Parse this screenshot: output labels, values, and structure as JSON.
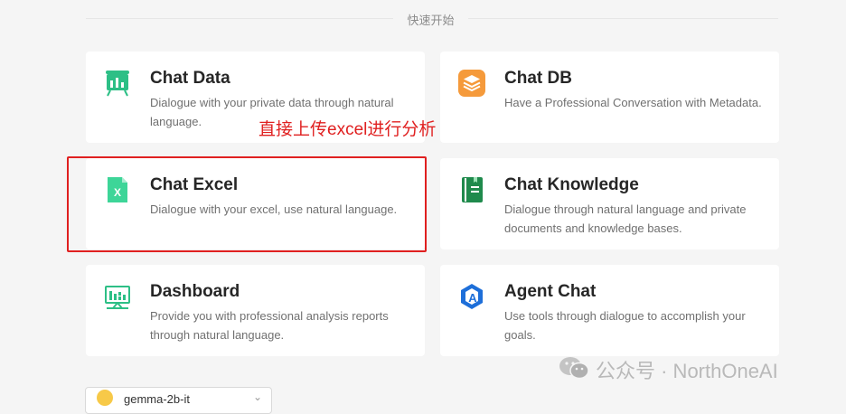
{
  "section": {
    "title": "快速开始"
  },
  "cards": [
    {
      "title": "Chat Data",
      "description": "Dialogue with your private data through natural language."
    },
    {
      "title": "Chat DB",
      "description": "Have a Professional Conversation with Metadata."
    },
    {
      "title": "Chat Excel",
      "description": "Dialogue with your excel, use natural language."
    },
    {
      "title": "Chat Knowledge",
      "description": "Dialogue through natural language and private documents and knowledge bases."
    },
    {
      "title": "Dashboard",
      "description": "Provide you with professional analysis reports through natural language."
    },
    {
      "title": "Agent Chat",
      "description": "Use tools through dialogue to accomplish your goals."
    }
  ],
  "annotation": {
    "text": "直接上传excel进行分析",
    "color": "#e02020"
  },
  "model_select": {
    "value": "gemma-2b-it"
  },
  "watermark": {
    "text": "公众号 · NorthOneAI"
  },
  "colors": {
    "accent_green": "#2dbf86",
    "db_orange": "#f59a3b",
    "knowledge_green": "#1f8a4c",
    "agent_blue": "#1e6fd9"
  }
}
